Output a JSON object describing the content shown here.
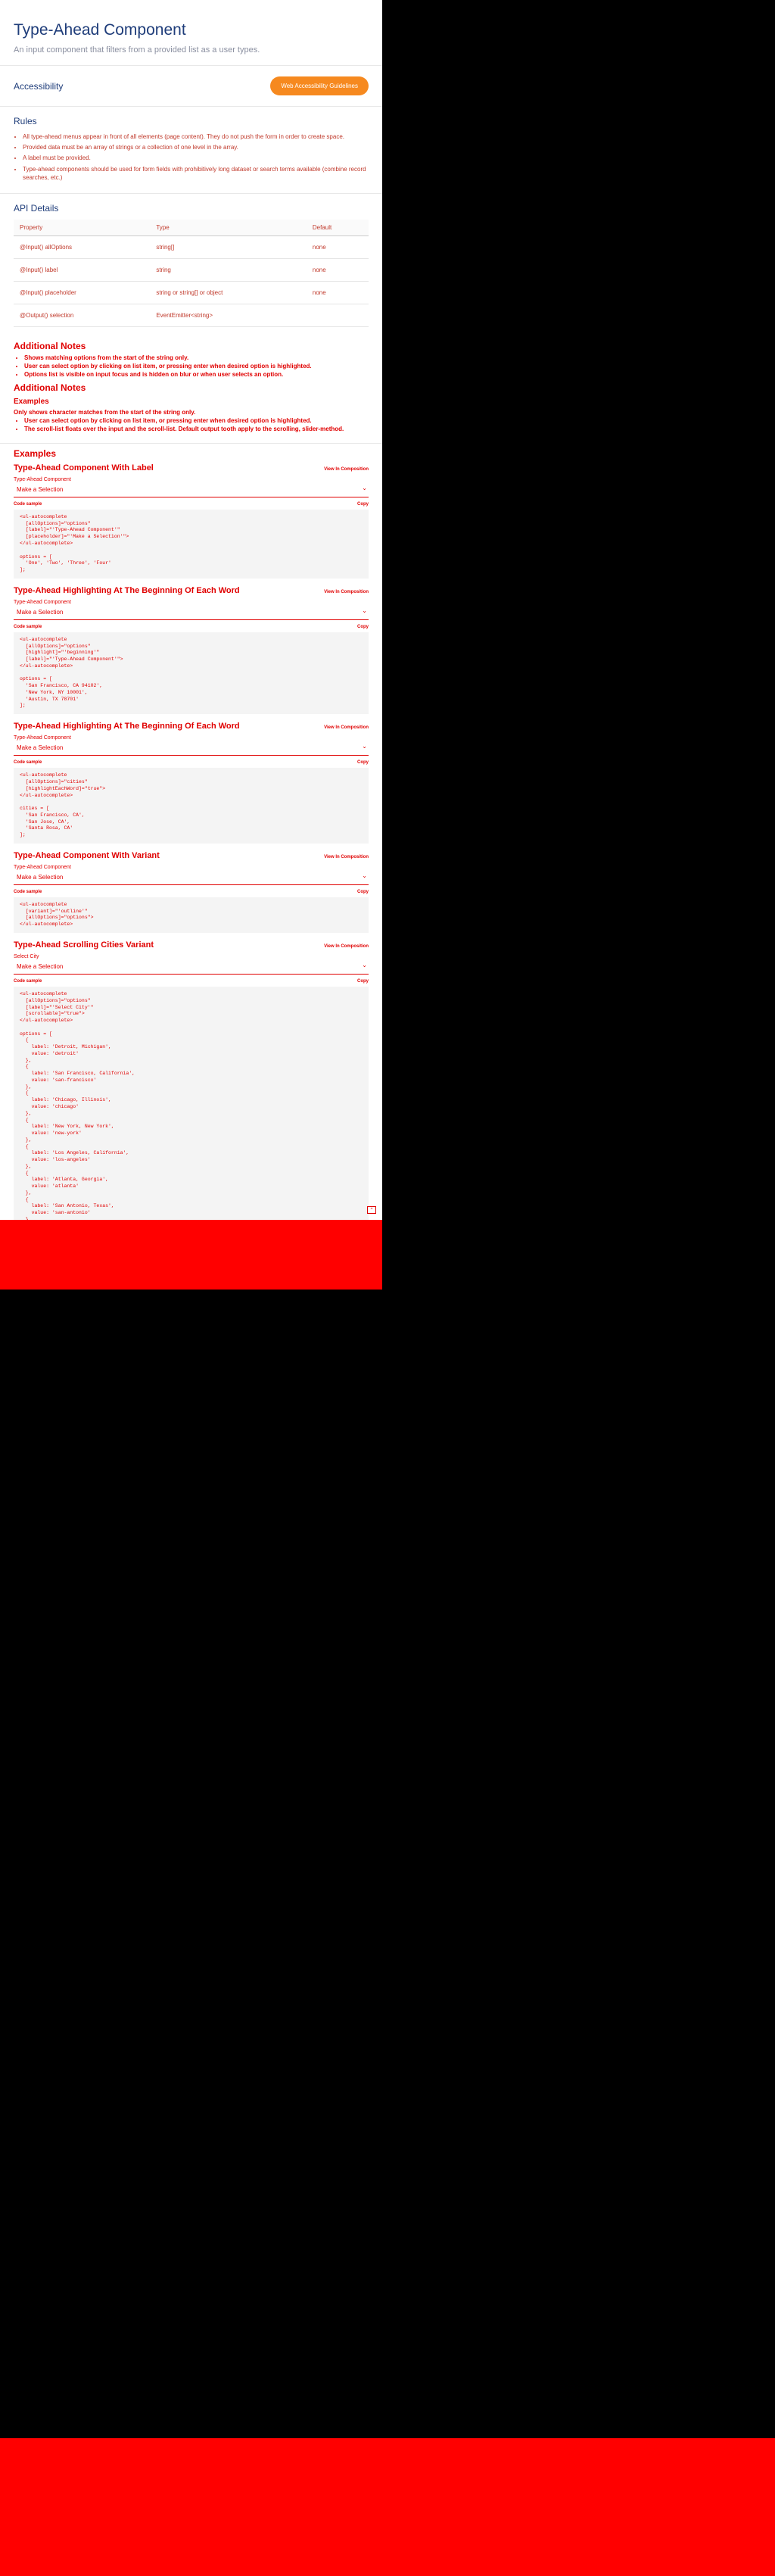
{
  "header": {
    "title": "Type-Ahead Component",
    "subtitle": "An input component that filters from a provided list as a user types."
  },
  "accessibility": {
    "heading": "Accessibility",
    "button_label": "Web Accessibility Guidelines"
  },
  "rules": {
    "heading": "Rules",
    "items": [
      "All type-ahead menus appear in front of all elements (page content). They do not push the form in order to create space.",
      "Provided data must be an array of strings or a collection of one level in the array.",
      "A label must be provided.",
      "Type-ahead components should be used for form fields with prohibitively long dataset or search terms available (combine record searches, etc.)"
    ]
  },
  "api": {
    "heading": "API Details",
    "columns": [
      "Property",
      "Type",
      "Default"
    ],
    "rows": [
      {
        "property": "@Input() allOptions",
        "type": "string[]",
        "default": "none"
      },
      {
        "property": "@Input() label",
        "type": "string",
        "default": "none"
      },
      {
        "property": "@Input() placeholder",
        "type": "string or string[] or object",
        "default": "none"
      },
      {
        "property": "@Output() selection",
        "type": "EventEmitter<string>",
        "default": ""
      }
    ]
  },
  "notes": {
    "heading": "Additional Notes",
    "items": [
      "Shows matching options from the start of the string only.",
      "User can select option by clicking on list item, or pressing enter when desired option is highlighted.",
      "Options list is visible on input focus and is hidden on blur or when user selects an option."
    ],
    "heading2": "Additional Notes",
    "variants_heading": "Examples",
    "variant_note": "Only shows character matches from the start of the string only.",
    "items2": [
      "User can select option by clicking on list item, or pressing enter when desired option is highlighted.",
      "The scroll-list floats over the input and the scroll-list. Default output tooth apply to the scrolling, slider-method."
    ]
  },
  "examples": {
    "heading": "Examples",
    "view_label": "View In Composition",
    "copy_label": "Copy",
    "code_label": "Code sample",
    "items": [
      {
        "title": "Type-Ahead Component With Label",
        "field_label": "Type-Ahead Component",
        "placeholder": "Make a Selection",
        "code": "<ul-autocomplete\n  [allOptions]=\"options\"\n  [label]=\"'Type-Ahead Component'\"\n  [placeholder]=\"'Make a Selection'\">\n</ul-autocomplete>\n\noptions = [\n  'One', 'Two', 'Three', 'Four'\n];"
      },
      {
        "title": "Type-Ahead Highlighting At The Beginning Of Each Word",
        "field_label": "Type-Ahead Component",
        "placeholder": "Make a Selection",
        "code": "<ul-autocomplete\n  [allOptions]=\"options\"\n  [highlight]=\"'beginning'\"\n  [label]=\"'Type-Ahead Component'\">\n</ul-autocomplete>\n\noptions = [\n  'San Francisco, CA 94102',\n  'New York, NY 10001',\n  'Austin, TX 78701'\n];"
      },
      {
        "title": "Type-Ahead Highlighting At The Beginning Of Each Word",
        "field_label": "Type-Ahead Component",
        "placeholder": "Make a Selection",
        "code": "<ul-autocomplete\n  [allOptions]=\"cities\"\n  [highlightEachWord]=\"true\">\n</ul-autocomplete>\n\ncities = [\n  'San Francisco, CA',\n  'San Jose, CA',\n  'Santa Rosa, CA'\n];"
      },
      {
        "title": "Type-Ahead Component With Variant",
        "field_label": "Type-Ahead Component",
        "placeholder": "Make a Selection",
        "code": "<ul-autocomplete\n  [variant]=\"'outline'\"\n  [allOptions]=\"options\">\n</ul-autocomplete>"
      },
      {
        "title": "Type-Ahead Scrolling Cities Variant",
        "field_label": "Select City",
        "placeholder": "Make a Selection",
        "code": "<ul-autocomplete\n  [allOptions]=\"options\"\n  [label]=\"'Select City'\"\n  [scrollable]=\"true\">\n</ul-autocomplete>\n\noptions = [\n  {\n    label: 'Detroit, Michigan',\n    value: 'detroit'\n  },\n  {\n    label: 'San Francisco, California',\n    value: 'san-francisco'\n  },\n  {\n    label: 'Chicago, Illinois',\n    value: 'chicago'\n  },\n  {\n    label: 'New York, New York',\n    value: 'new-york'\n  },\n  {\n    label: 'Los Angeles, California',\n    value: 'los-angeles'\n  },\n  {\n    label: 'Atlanta, Georgia',\n    value: 'atlanta'\n  },\n  {\n    label: 'San Antonio, Texas',\n    value: 'san-antonio'\n  },\n  {\n    label: 'Philadelphia, Pennsylvania',\n    value: 'philadelphia'\n  },\n  {\n    label: 'Houston, Texas',\n    value: 'houston'\n  }\n];\n\nonSelection(option: string) {\n  this.selected = option;\n}"
      }
    ]
  },
  "scroll_button": "^"
}
